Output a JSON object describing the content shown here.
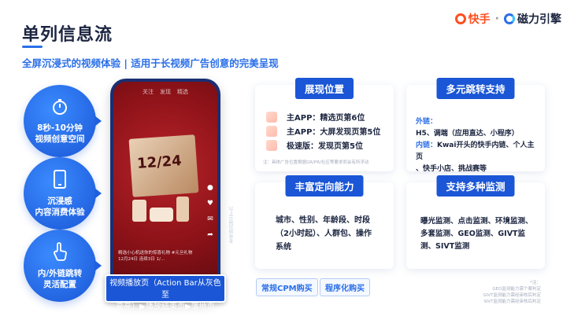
{
  "header": {
    "title": "单列信息流",
    "subtitle": "全屏沉浸式的视频体验 | 适用于长视频广告创意的完美呈现",
    "logo_kuaishou": "快手",
    "logo_separator": "·",
    "logo_cili": "磁力引擎"
  },
  "features": [
    {
      "icon": "stopwatch-icon",
      "line1": "8秒-10分钟",
      "line2": "视频创意空间"
    },
    {
      "icon": "phone-icon",
      "line1": "沉浸感",
      "line2": "内容消费体验"
    },
    {
      "icon": "pointer-icon",
      "line1": "内/外链跳转",
      "line2": "灵活配置"
    }
  ],
  "phone": {
    "tabs": [
      "关注",
      "发现",
      "精选"
    ],
    "date_text": "12/24",
    "caption": "精选小心机送你的惊喜礼物 #元旦礼物 12月24日 连续3日 1/...",
    "banner_line1": "视频播放页（Action Bar从灰色至",
    "banner_line2": "高亮）▶播放结束页▶落地页",
    "vertical_watermark": "以上示例仅供参考"
  },
  "cards": {
    "placement": {
      "tag": "展现位置",
      "lines": [
        "主APP：精选页第6位",
        "主APP：大屏发现页第5位",
        "极速版：发现页第5位"
      ],
      "note": "注：具体广告位置根据GR/PR/社区等要求而会有所浮动"
    },
    "jump": {
      "tag": "多元跳转支持",
      "outer_label": "外链：",
      "outer_text": "H5、调端（应用直达、小程序）",
      "inner_label": "内链：",
      "inner_text": "Kwai开头的快手内链、个人主页",
      "inner_text2": "、快手小店、挑战赛等"
    },
    "targeting": {
      "tag": "丰富定向能力",
      "text": "城市、性别、年龄段、时段（2小时起）、人群包、操作系统"
    },
    "monitoring": {
      "tag": "支持多种监测",
      "text": "曝光监测、点击监测、环境监测、多套监测、GEO监测、GIVT监测、SIVT监测"
    }
  },
  "pills": [
    "常规CPM购买",
    "程序化购买"
  ],
  "footnote": [
    "*注：",
    "GEO监测能力需个案判定",
    "GIVT监测能力需经审核后判定",
    "SIVT监测能力需经审核后判定"
  ],
  "colors": {
    "accent": "#1a56d6",
    "highlight": "#2b6fe8",
    "kuaishou": "#ff4f1f"
  }
}
